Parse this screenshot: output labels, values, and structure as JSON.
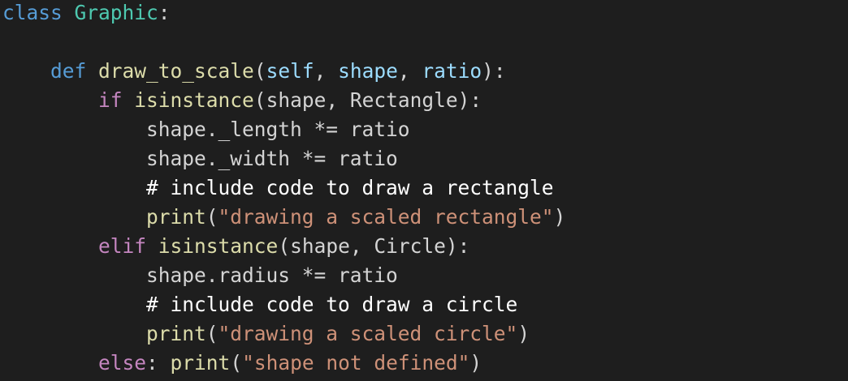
{
  "editor": {
    "language": "python",
    "theme": "dark",
    "colors": {
      "background": "#1e1e1e",
      "keyword": "#569cd6",
      "class_name": "#4ec9b0",
      "function_name": "#dcdcaa",
      "parameter": "#9cdcfe",
      "control_keyword": "#c586c0",
      "plain": "#d4d4d4",
      "string": "#ce9178",
      "comment": "#ffffff"
    },
    "lines": [
      {
        "tokens": [
          {
            "text": "class",
            "kind": "keyword"
          },
          {
            "text": " ",
            "kind": "plain"
          },
          {
            "text": "Graphic",
            "kind": "class"
          },
          {
            "text": ":",
            "kind": "plain"
          }
        ]
      },
      {
        "tokens": []
      },
      {
        "tokens": [
          {
            "text": "    ",
            "kind": "plain"
          },
          {
            "text": "def",
            "kind": "keyword"
          },
          {
            "text": " ",
            "kind": "plain"
          },
          {
            "text": "draw_to_scale",
            "kind": "func"
          },
          {
            "text": "(",
            "kind": "plain"
          },
          {
            "text": "self",
            "kind": "param"
          },
          {
            "text": ", ",
            "kind": "plain"
          },
          {
            "text": "shape",
            "kind": "param"
          },
          {
            "text": ", ",
            "kind": "plain"
          },
          {
            "text": "ratio",
            "kind": "param"
          },
          {
            "text": "):",
            "kind": "plain"
          }
        ]
      },
      {
        "tokens": [
          {
            "text": "        ",
            "kind": "plain"
          },
          {
            "text": "if",
            "kind": "control"
          },
          {
            "text": " ",
            "kind": "plain"
          },
          {
            "text": "isinstance",
            "kind": "func"
          },
          {
            "text": "(shape, Rectangle):",
            "kind": "plain"
          }
        ]
      },
      {
        "tokens": [
          {
            "text": "            shape._length *= ratio",
            "kind": "plain"
          }
        ]
      },
      {
        "tokens": [
          {
            "text": "            shape._width *= ratio",
            "kind": "plain"
          }
        ]
      },
      {
        "tokens": [
          {
            "text": "            ",
            "kind": "plain"
          },
          {
            "text": "# include code to draw a rectangle",
            "kind": "comment"
          }
        ]
      },
      {
        "tokens": [
          {
            "text": "            ",
            "kind": "plain"
          },
          {
            "text": "print",
            "kind": "func"
          },
          {
            "text": "(",
            "kind": "plain"
          },
          {
            "text": "\"drawing a scaled rectangle\"",
            "kind": "string"
          },
          {
            "text": ")",
            "kind": "plain"
          }
        ]
      },
      {
        "tokens": [
          {
            "text": "        ",
            "kind": "plain"
          },
          {
            "text": "elif",
            "kind": "control"
          },
          {
            "text": " ",
            "kind": "plain"
          },
          {
            "text": "isinstance",
            "kind": "func"
          },
          {
            "text": "(shape, Circle):",
            "kind": "plain"
          }
        ]
      },
      {
        "tokens": [
          {
            "text": "            shape.radius *= ratio",
            "kind": "plain"
          }
        ]
      },
      {
        "tokens": [
          {
            "text": "            ",
            "kind": "plain"
          },
          {
            "text": "# include code to draw a circle",
            "kind": "comment"
          }
        ]
      },
      {
        "tokens": [
          {
            "text": "            ",
            "kind": "plain"
          },
          {
            "text": "print",
            "kind": "func"
          },
          {
            "text": "(",
            "kind": "plain"
          },
          {
            "text": "\"drawing a scaled circle\"",
            "kind": "string"
          },
          {
            "text": ")",
            "kind": "plain"
          }
        ]
      },
      {
        "tokens": [
          {
            "text": "        ",
            "kind": "plain"
          },
          {
            "text": "else",
            "kind": "control"
          },
          {
            "text": ": ",
            "kind": "plain"
          },
          {
            "text": "print",
            "kind": "func"
          },
          {
            "text": "(",
            "kind": "plain"
          },
          {
            "text": "\"shape not defined\"",
            "kind": "string"
          },
          {
            "text": ")",
            "kind": "plain"
          }
        ]
      }
    ]
  }
}
